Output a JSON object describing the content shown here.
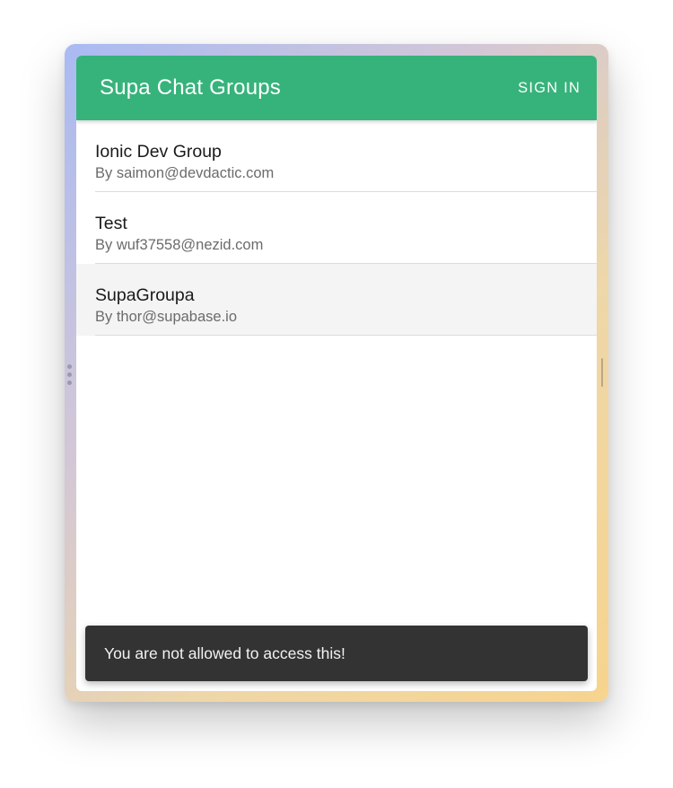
{
  "app": {
    "title": "Supa Chat Groups",
    "sign_in_label": "SIGN IN"
  },
  "groups": [
    {
      "name": "Ionic Dev Group",
      "creator": "By saimon@devdactic.com"
    },
    {
      "name": "Test",
      "creator": "By wuf37558@nezid.com"
    },
    {
      "name": "SupaGroupa",
      "creator": "By thor@supabase.io"
    }
  ],
  "toast": {
    "message": "You are not allowed to access this!"
  },
  "colors": {
    "toolbar": "#36b37b",
    "toast_background": "#333333",
    "selected_row": "#f4f4f4"
  }
}
